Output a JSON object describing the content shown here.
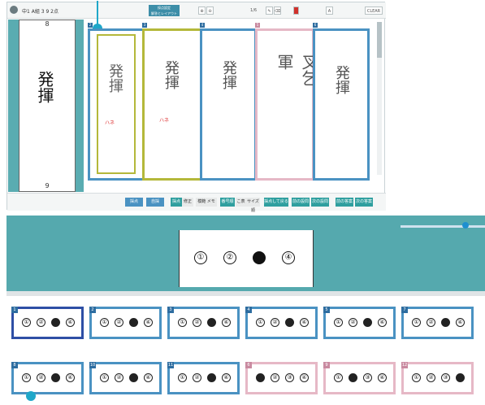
{
  "toolbar": {
    "title_text": "中1  A組  3 9  2点",
    "page_indicator": "1/6",
    "clear_label": "CLEAR",
    "mode_label_top": "採点設定",
    "mode_label_bottom": "解答とレイアウト"
  },
  "answer_text": {
    "reference": "発揮",
    "note": "ハネ"
  },
  "top_cells": [
    {
      "no": "1",
      "state": "selected-reference",
      "top_number": "8",
      "bottom_number": "9"
    },
    {
      "no": "2",
      "state": "olive",
      "top_number": "8",
      "bottom_number": "9"
    },
    {
      "no": "3",
      "state": "olive",
      "top_number": "8",
      "bottom_number": "9"
    },
    {
      "no": "4",
      "state": "blue",
      "top_number": "",
      "bottom_number": "9"
    },
    {
      "no": "5",
      "state": "pink",
      "top_number": "",
      "bottom_number": "9"
    },
    {
      "no": "6",
      "state": "blue",
      "top_number": "8",
      "bottom_number": "9"
    }
  ],
  "bottom_bar": {
    "buttons": [
      "採点",
      "自採",
      "採点",
      "修正",
      "模範 メモ",
      "番号順",
      "こ表",
      "サイズ順",
      "採点して戻る",
      "前の設問",
      "次の設問",
      "前の答案",
      "次の答案"
    ]
  },
  "hero": {
    "bubbles": [
      "①",
      "②",
      "●",
      "④"
    ]
  },
  "tiles": [
    {
      "no": "1",
      "marks": [
        "①",
        "②",
        "●",
        "④"
      ],
      "style": "selected"
    },
    {
      "no": "2",
      "marks": [
        "①",
        "②",
        "●",
        "④"
      ],
      "style": "blue"
    },
    {
      "no": "3",
      "marks": [
        "①",
        "②",
        "●",
        "④"
      ],
      "style": "blue"
    },
    {
      "no": "4",
      "marks": [
        "①",
        "②",
        "●",
        "④"
      ],
      "style": "blue"
    },
    {
      "no": "5",
      "marks": [
        "①",
        "②",
        "●",
        "④"
      ],
      "style": "blue"
    },
    {
      "no": "7",
      "marks": [
        "①",
        "②",
        "●",
        "④"
      ],
      "style": "blue"
    },
    {
      "no": "8",
      "marks": [
        "①",
        "②",
        "●",
        "④"
      ],
      "style": "blue"
    },
    {
      "no": "10",
      "marks": [
        "①",
        "②",
        "●",
        "④"
      ],
      "style": "blue"
    },
    {
      "no": "11",
      "marks": [
        "①",
        "②",
        "●",
        "④"
      ],
      "style": "blue"
    },
    {
      "no": "6",
      "marks": [
        "●",
        "②",
        "③",
        "④"
      ],
      "style": "pink"
    },
    {
      "no": "9",
      "marks": [
        "①",
        "●",
        "③",
        "④"
      ],
      "style": "pink"
    },
    {
      "no": "12",
      "marks": [
        "①",
        "②",
        "③",
        "●"
      ],
      "style": "pink"
    }
  ],
  "colors": {
    "teal": "#55a9ae",
    "blue_border": "#4a92c2",
    "olive_border": "#b4b83a",
    "pink_border": "#e6b8c6",
    "dark_blue": "#2e6da0"
  }
}
